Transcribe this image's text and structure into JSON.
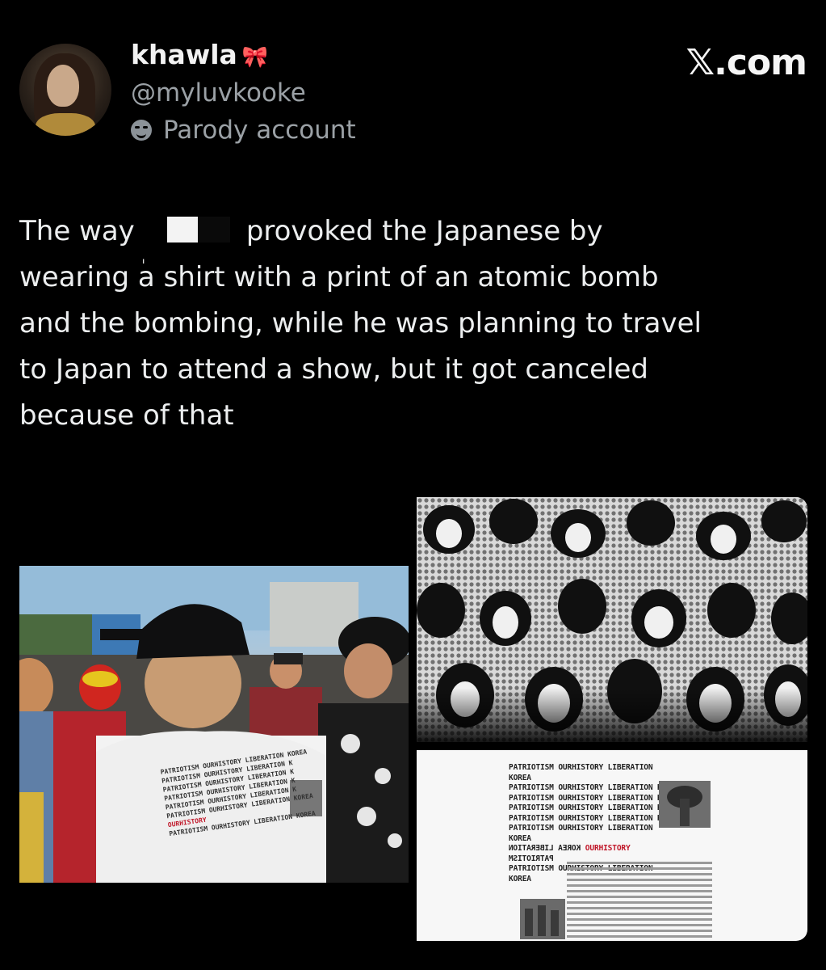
{
  "author": {
    "display_name": "khawla",
    "name_emoji": "🎀",
    "handle": "@myluvkooke",
    "label": "Parody account",
    "label_icon": "parody-mask-icon"
  },
  "brand": "𝕏.com",
  "tweet": {
    "text_before": "The way",
    "text_after": "provoked the Japanese by\nwearing a shirt with a print of an atomic bomb\nand the bombing, while he was planning to travel\nto Japan to attend a show, but it got canceled\nbecause of that",
    "redaction_mark": "ˌ"
  },
  "shirt_print": {
    "lines": [
      "PATRIOTISM OURHISTORY LIBERATION KOREA",
      "PATRIOTISM OURHISTORY LIBERATION K",
      "PATRIOTISM OURHISTORY LIBERATION K",
      "PATRIOTISM OURHISTORY LIBERATION K",
      "PATRIOTISM OURHISTORY LIBERATION K",
      "PATRIOTISM OURHISTORY LIBERATION KOREA"
    ],
    "mirrored_prefix": "KOREA LIBERATION",
    "highlight": "OURHISTORY",
    "mirrored_suffix": "PATRIOTISM",
    "last_line": "PATRIOTISM OURHISTORY LIBERATION KOREA"
  }
}
